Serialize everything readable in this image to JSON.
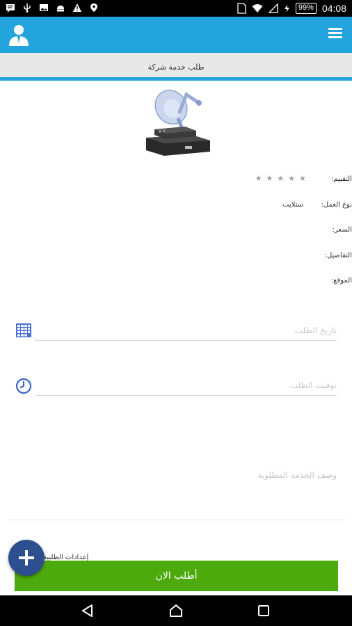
{
  "status_bar": {
    "time": "04:08",
    "battery": "99%",
    "left_icons": [
      "message-icon",
      "usb-icon",
      "image-icon",
      "android-icon",
      "warning-icon",
      "location-icon"
    ],
    "right_icons": [
      "sim-icon",
      "wifi-icon",
      "signal-icon",
      "charging-icon"
    ]
  },
  "app_bar": {
    "profile_icon": "user-profile-icon",
    "menu_icon": "hamburger-menu-icon",
    "color": "#23a4dc"
  },
  "page_title": "طلب خدمة شركة",
  "service": {
    "image": "satellite-dish-receiver-image",
    "rating_label": "التقييم:",
    "rating_stars": "★★★★★",
    "rating_value": 0,
    "work_type_label": "نوع العمل:",
    "work_type_value": "ستلايت",
    "price_label": "السعر:",
    "details_label": "التفاصيل:",
    "location_label": "الموقع:"
  },
  "form": {
    "date_placeholder": "تاريخ الطلب",
    "date_icon": "calendar-icon",
    "time_placeholder": "توقيت الطلب",
    "time_icon": "clock-icon",
    "description_placeholder": "وصف الخدمة المطلوبة",
    "settings_link": "إعدادات الطلبية"
  },
  "actions": {
    "order_now": "أطلب الان",
    "fab_icon": "plus-icon",
    "order_color": "#4caa0d",
    "fab_color": "#2d4e8f"
  },
  "nav_bar": {
    "back_icon": "back-icon",
    "home_icon": "home-icon",
    "recents_icon": "recents-icon"
  }
}
